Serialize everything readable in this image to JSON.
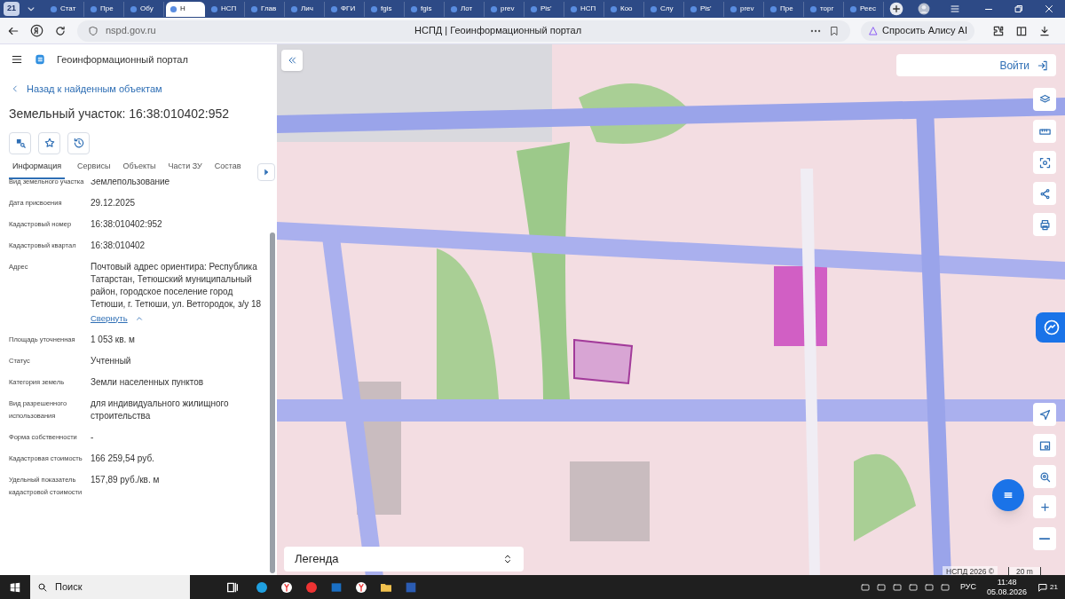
{
  "browser": {
    "tab_count": "21",
    "tabs": [
      {
        "label": "Стат",
        "selected": false
      },
      {
        "label": "Пре",
        "selected": false
      },
      {
        "label": "Обу",
        "selected": false
      },
      {
        "label": "Н",
        "selected": true
      },
      {
        "label": "НСП",
        "selected": false
      },
      {
        "label": "Глав",
        "selected": false
      },
      {
        "label": "Лич",
        "selected": false
      },
      {
        "label": "ФГИ",
        "selected": false
      },
      {
        "label": "fgis",
        "selected": false
      },
      {
        "label": "fgis",
        "selected": false
      },
      {
        "label": "Лот",
        "selected": false
      },
      {
        "label": "prev",
        "selected": false
      },
      {
        "label": "Pis'",
        "selected": false
      },
      {
        "label": "НСП",
        "selected": false
      },
      {
        "label": "Коо",
        "selected": false
      },
      {
        "label": "Слу",
        "selected": false
      },
      {
        "label": "Pis'",
        "selected": false
      },
      {
        "label": "prev",
        "selected": false
      },
      {
        "label": "Пре",
        "selected": false
      },
      {
        "label": "торг",
        "selected": false
      },
      {
        "label": "Реес",
        "selected": false
      }
    ],
    "url": "nspd.gov.ru",
    "page_title": "НСПД | Геоинформационный портал",
    "assistant_button": "Спросить Алису AI"
  },
  "sidebar": {
    "portal_title": "Геоинформационный портал",
    "back_link": "Назад к найденным объектам",
    "heading": "Земельный участок: 16:38:010402:952",
    "tabs": [
      {
        "label": "Информация",
        "selected": true
      },
      {
        "label": "Сервисы",
        "selected": false
      },
      {
        "label": "Объекты",
        "selected": false
      },
      {
        "label": "Части ЗУ",
        "selected": false
      },
      {
        "label": "Состав",
        "selected": false
      }
    ],
    "fields": [
      {
        "label": "Вид земельного участка",
        "value": "Землепользование"
      },
      {
        "label": "Дата присвоения",
        "value": "29.12.2025"
      },
      {
        "label": "Кадастровый номер",
        "value": "16:38:010402:952"
      },
      {
        "label": "Кадастровый квартал",
        "value": "16:38:010402"
      },
      {
        "label": "Адрес",
        "value": "Почтовый адрес ориентира: Республика Татарстан, Тетюшский муниципальный район, городское поселение город Тетюши, г. Тетюши, ул. Ветгородок, з/у 18",
        "toggle_link": "Свернуть"
      },
      {
        "label": "Площадь уточненная",
        "value": "1 053 кв. м"
      },
      {
        "label": "Статус",
        "value": "Учтенный"
      },
      {
        "label": "Категория земель",
        "value": "Земли населенных пунктов"
      },
      {
        "label": "Вид разрешенного использования",
        "value": "для индивидуального жилищного строительства"
      },
      {
        "label": "Форма собственности",
        "value": "-"
      },
      {
        "label": "Кадастровая стоимость",
        "value": "166 259,54 руб."
      },
      {
        "label": "Удельный показатель кадастровой стоимости",
        "value": "157,89 руб./кв. м"
      }
    ]
  },
  "map": {
    "kind": "picture",
    "login_button": "Войти",
    "legend": "Легенда",
    "copyright": "НСПД 2026 ©",
    "scale": "20 m"
  },
  "taskbar": {
    "search": "Поиск",
    "language": "РУС",
    "time": "11:48",
    "date": "05.08.2026",
    "notifications": "21"
  }
}
